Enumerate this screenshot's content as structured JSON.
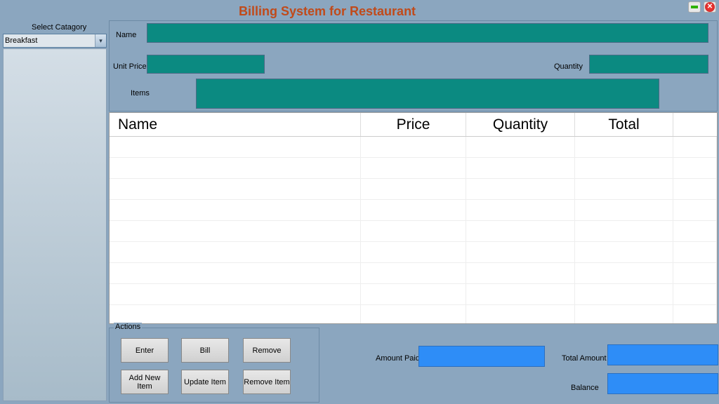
{
  "window": {
    "title": "Billing System for Restaurant"
  },
  "category": {
    "label": "Select Catagory",
    "selected": "Breakfast"
  },
  "form": {
    "name_label": "Name",
    "unit_price_label": "Unit Price",
    "quantity_label": "Quantity",
    "items_label": "Items",
    "name_value": "",
    "unit_price_value": "",
    "quantity_value": "",
    "items_value": ""
  },
  "grid": {
    "headers": {
      "name": "Name",
      "price": "Price",
      "quantity": "Quantity",
      "total": "Total"
    }
  },
  "actions": {
    "legend": "Actions",
    "enter": "Enter",
    "bill": "Bill",
    "remove": "Remove",
    "add_new_item": "Add New Item",
    "update_item": "Update Item",
    "remove_item": "Remove Item"
  },
  "payment": {
    "amount_paid_label": "Amount Paid",
    "total_amount_label": "Total Amount",
    "balance_label": "Balance",
    "amount_paid_value": "",
    "total_amount_value": "",
    "balance_value": ""
  }
}
